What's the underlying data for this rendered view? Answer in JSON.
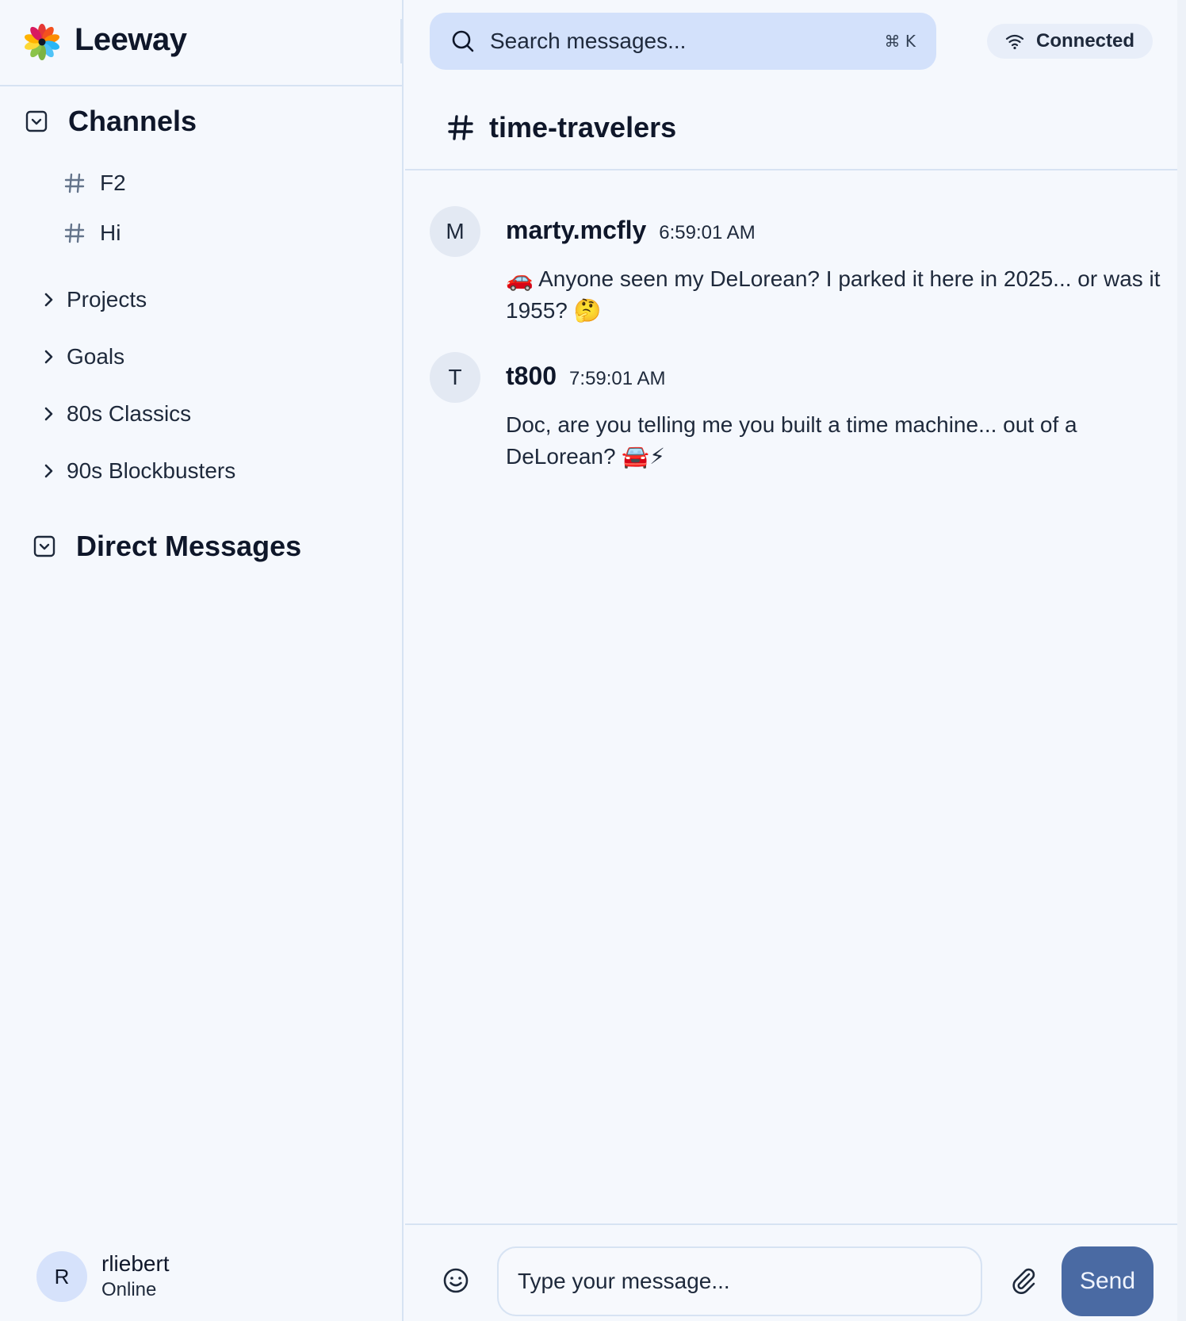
{
  "app": {
    "name": "Leeway"
  },
  "search": {
    "placeholder": "Search messages...",
    "shortcut": "⌘ K"
  },
  "connection": {
    "label": "Connected"
  },
  "sidebar": {
    "channels_title": "Channels",
    "channels": [
      {
        "label": "F2"
      },
      {
        "label": "Hi"
      }
    ],
    "folders": [
      {
        "label": "Projects"
      },
      {
        "label": "Goals"
      },
      {
        "label": "80s Classics"
      },
      {
        "label": "90s Blockbusters"
      }
    ],
    "dm_title": "Direct Messages",
    "user": {
      "initial": "R",
      "name": "rliebert",
      "status": "Online"
    }
  },
  "channel": {
    "name": "time-travelers"
  },
  "messages": [
    {
      "avatar": "M",
      "author": "marty.mcfly",
      "time": "6:59:01 AM",
      "text": "🚗 Anyone seen my DeLorean? I parked it here in 2025... or was it 1955? 🤔"
    },
    {
      "avatar": "T",
      "author": "t800",
      "time": "7:59:01 AM",
      "text": "Doc, are you telling me you built a time machine... out of a DeLorean? 🚘⚡"
    }
  ],
  "composer": {
    "placeholder": "Type your message...",
    "send_label": "Send"
  },
  "icons": {
    "logo": "leeway-flower-logo",
    "search": "search-icon",
    "wifi": "wifi-icon",
    "section_toggle": "chevron-down-square-icon",
    "hash": "hash-icon",
    "chevron": "chevron-right-icon",
    "emoji": "smiley-icon",
    "attach": "paperclip-icon"
  },
  "colors": {
    "background": "#f5f8fd",
    "search_bg": "#d3e1fb",
    "accent_send": "#4a6aa3",
    "border": "#d7e3f3"
  }
}
